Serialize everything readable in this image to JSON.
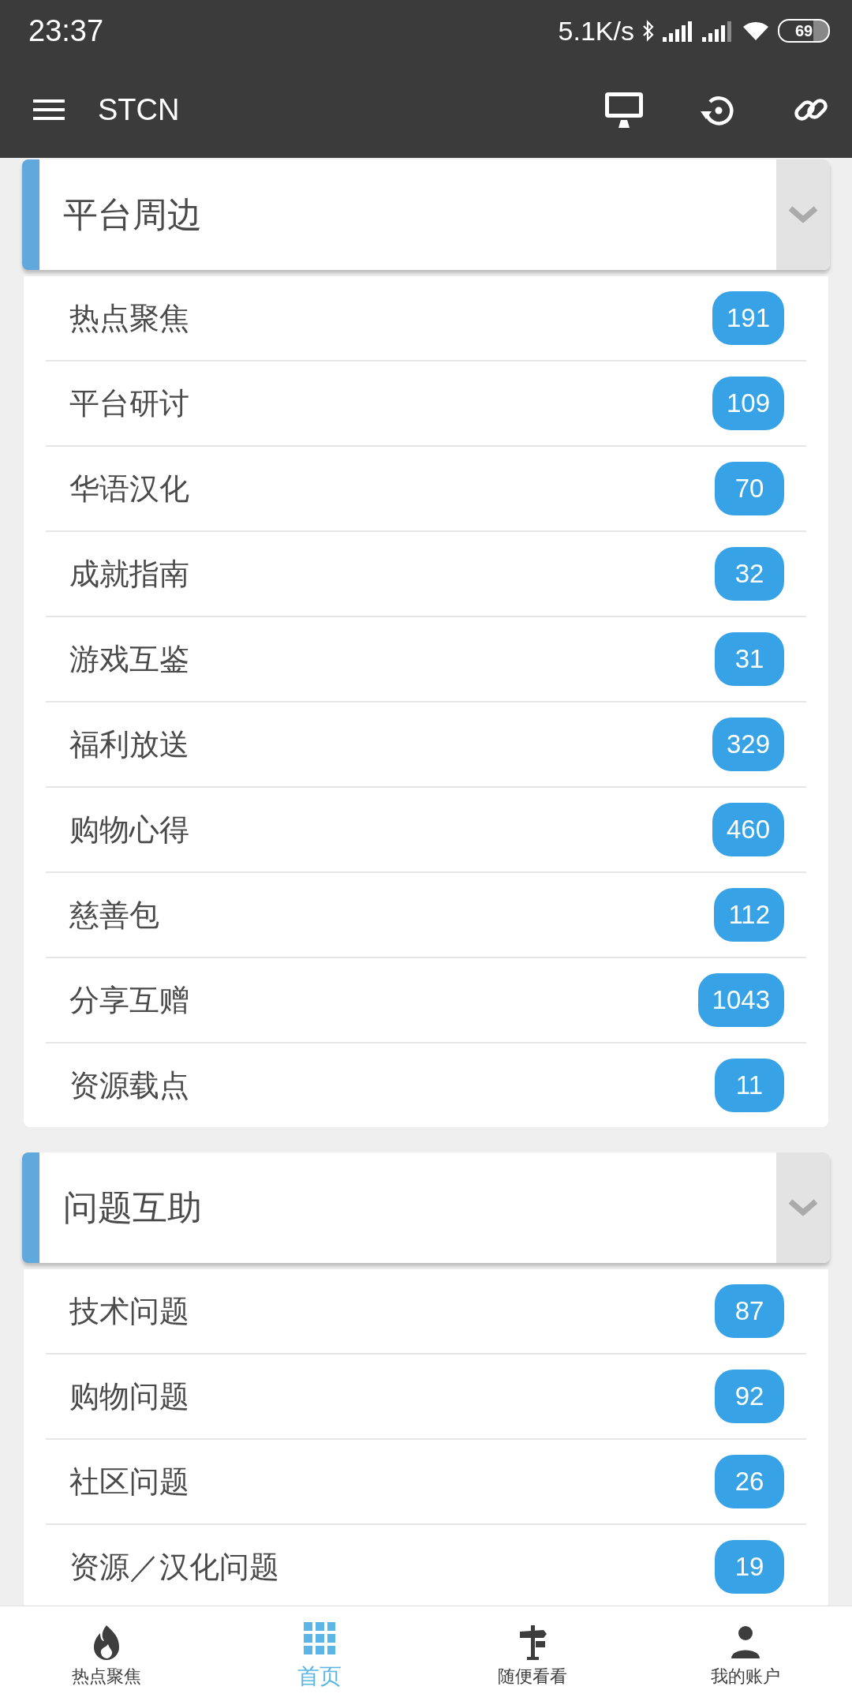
{
  "status_bar": {
    "time": "23:37",
    "speed": "5.1K/s",
    "battery": "69"
  },
  "toolbar": {
    "title": "STCN"
  },
  "sections": [
    {
      "title": "平台周边",
      "items": [
        {
          "label": "热点聚焦",
          "count": "191"
        },
        {
          "label": "平台研讨",
          "count": "109"
        },
        {
          "label": "华语汉化",
          "count": "70"
        },
        {
          "label": "成就指南",
          "count": "32"
        },
        {
          "label": "游戏互鉴",
          "count": "31"
        },
        {
          "label": "福利放送",
          "count": "329"
        },
        {
          "label": "购物心得",
          "count": "460"
        },
        {
          "label": "慈善包",
          "count": "112"
        },
        {
          "label": "分享互赠",
          "count": "1043"
        },
        {
          "label": "资源载点",
          "count": "11"
        }
      ]
    },
    {
      "title": "问题互助",
      "items": [
        {
          "label": "技术问题",
          "count": "87"
        },
        {
          "label": "购物问题",
          "count": "92"
        },
        {
          "label": "社区问题",
          "count": "26"
        },
        {
          "label": "资源／汉化问题",
          "count": "19"
        }
      ]
    }
  ],
  "bottom_nav": [
    {
      "kind": "flame",
      "label": "热点聚焦",
      "selected": false
    },
    {
      "kind": "grid",
      "label": "首页",
      "selected": true
    },
    {
      "kind": "signpost",
      "label": "随便看看",
      "selected": false
    },
    {
      "kind": "person",
      "label": "我的账户",
      "selected": false
    }
  ]
}
